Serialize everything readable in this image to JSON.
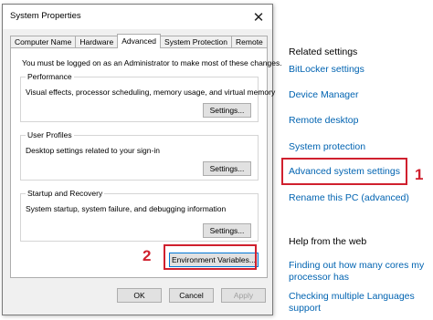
{
  "dialog": {
    "title": "System Properties",
    "close_glyph": "✕",
    "tabs": [
      {
        "label": "Computer Name"
      },
      {
        "label": "Hardware"
      },
      {
        "label": "Advanced"
      },
      {
        "label": "System Protection"
      },
      {
        "label": "Remote"
      }
    ],
    "admin_note": "You must be logged on as an Administrator to make most of these changes.",
    "groups": [
      {
        "title": "Performance",
        "description": "Visual effects, processor scheduling, memory usage, and virtual memory",
        "button": "Settings..."
      },
      {
        "title": "User Profiles",
        "description": "Desktop settings related to your sign-in",
        "button": "Settings..."
      },
      {
        "title": "Startup and Recovery",
        "description": "System startup, system failure, and debugging information",
        "button": "Settings..."
      }
    ],
    "env_button": "Environment Variables...",
    "ok_label": "OK",
    "cancel_label": "Cancel",
    "apply_label": "Apply"
  },
  "annotations": {
    "marker_1": "1",
    "marker_2": "2",
    "highlight_color": "#d0202e"
  },
  "related": {
    "heading": "Related settings",
    "links": [
      {
        "label": "BitLocker settings"
      },
      {
        "label": "Device Manager"
      },
      {
        "label": "Remote desktop"
      },
      {
        "label": "System protection"
      },
      {
        "label": "Advanced system settings"
      },
      {
        "label": "Rename this PC (advanced)"
      }
    ]
  },
  "help": {
    "heading": "Help from the web",
    "links": [
      {
        "line1": "Finding out how many cores my",
        "line2": "processor has"
      },
      {
        "line1": "Checking multiple Languages",
        "line2": "support"
      }
    ]
  },
  "colors": {
    "link": "#0063b1",
    "dialog_bg": "#f0f0f0"
  }
}
